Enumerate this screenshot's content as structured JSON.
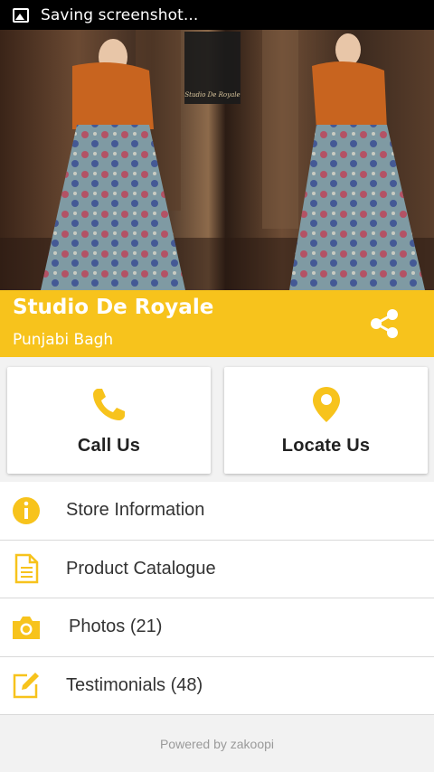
{
  "status_bar": {
    "text": "Saving screenshot..."
  },
  "banner": {
    "logo_text": "Studio De Royale"
  },
  "store": {
    "name": "Studio De Royale",
    "location": "Punjabi Bagh"
  },
  "actions": [
    {
      "label": "Call Us",
      "icon": "phone-icon"
    },
    {
      "label": "Locate Us",
      "icon": "map-pin-icon"
    }
  ],
  "menu": [
    {
      "label": "Store Information",
      "icon": "info-icon"
    },
    {
      "label": "Product Catalogue",
      "icon": "document-icon"
    },
    {
      "label": "Photos (21)",
      "icon": "camera-icon"
    },
    {
      "label": "Testimonials (48)",
      "icon": "edit-icon"
    }
  ],
  "footer": {
    "text": "Powered by zakoopi"
  },
  "colors": {
    "accent": "#f7c31c",
    "status_bar": "#000000",
    "background": "#f2f2f2"
  }
}
